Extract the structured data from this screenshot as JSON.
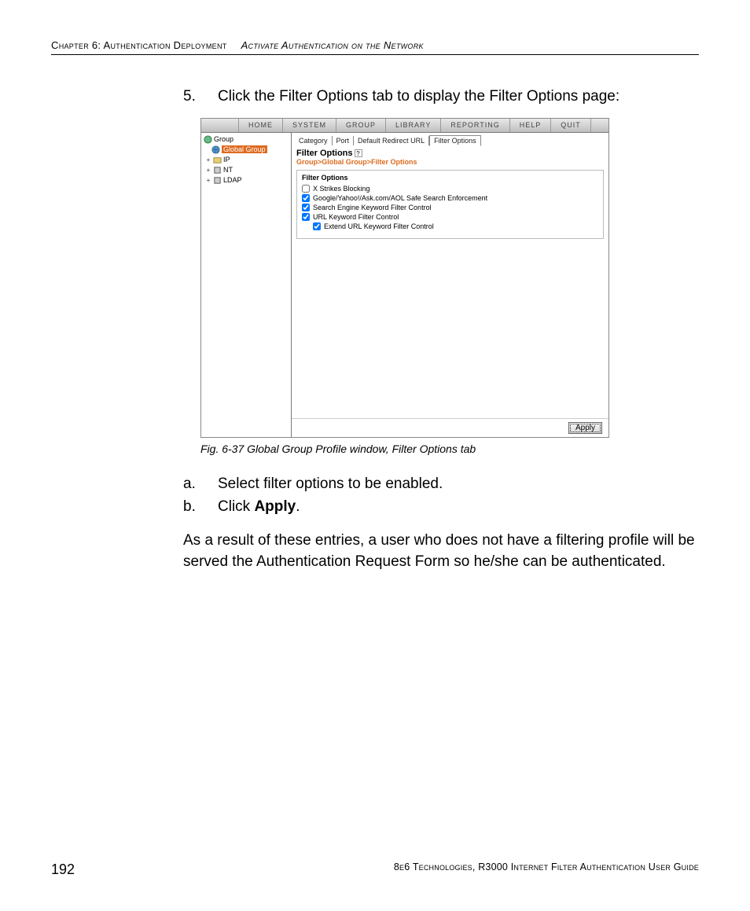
{
  "header": {
    "left": "Chapter 6: Authentication Deployment",
    "right": "Activate Authentication on the Network"
  },
  "step5": {
    "num": "5.",
    "text": "Click the Filter Options tab to display the Filter Options page:"
  },
  "figcaption": "Fig. 6-37  Global Group Profile window, Filter Options tab",
  "substeps": {
    "a": {
      "label": "a.",
      "text": "Select filter options to be enabled."
    },
    "b": {
      "label": "b.",
      "prefix": "Click ",
      "bold": "Apply",
      "suffix": "."
    }
  },
  "para": "As a result of these entries, a user who does not have a filtering profile will be served the Authentication Request Form so he/she can be authenticated.",
  "footer": {
    "page": "192",
    "text": "8e6 Technologies, R3000 Internet Filter Authentication User Guide"
  },
  "app": {
    "menu": [
      "HOME",
      "SYSTEM",
      "GROUP",
      "LIBRARY",
      "REPORTING",
      "HELP",
      "QUIT"
    ],
    "tree": {
      "root": "Group",
      "items": [
        {
          "label": "Global Group",
          "selected": true
        },
        {
          "label": "IP",
          "expander": "+"
        },
        {
          "label": "NT",
          "expander": "+"
        },
        {
          "label": "LDAP",
          "expander": "+"
        }
      ]
    },
    "tabs": [
      "Category",
      "Port",
      "Default Redirect URL",
      "Filter Options"
    ],
    "active_tab": 3,
    "panel_title": "Filter Options",
    "breadcrumb": "Group>Global Group>Filter Options",
    "group_title": "Filter Options",
    "checks": [
      {
        "label": "X Strikes Blocking",
        "checked": false
      },
      {
        "label": "Google/Yahoo!/Ask.com/AOL Safe Search Enforcement",
        "checked": true
      },
      {
        "label": "Search Engine Keyword Filter Control",
        "checked": true
      },
      {
        "label": "URL Keyword Filter Control",
        "checked": true
      },
      {
        "label": "Extend URL Keyword Filter Control",
        "checked": true,
        "indent": true
      }
    ],
    "apply": "Apply"
  }
}
